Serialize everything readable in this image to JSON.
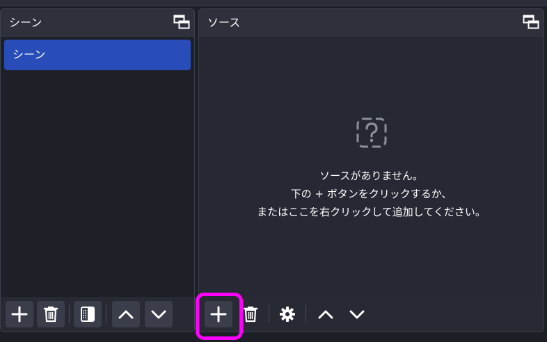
{
  "scenes": {
    "title": "シーン",
    "items": [
      {
        "label": "シーン"
      }
    ],
    "toolbar": [
      {
        "name": "add-scene-button",
        "icon": "plus-icon"
      },
      {
        "name": "remove-scene-button",
        "icon": "trash-icon"
      },
      {
        "name": "scene-filters-button",
        "icon": "filter-icon"
      },
      {
        "name": "move-scene-up-button",
        "icon": "chevron-up-icon"
      },
      {
        "name": "move-scene-down-button",
        "icon": "chevron-down-icon"
      }
    ]
  },
  "sources": {
    "title": "ソース",
    "empty": {
      "line1": "ソースがありません。",
      "line2": "下の + ボタンをクリックするか、",
      "line3": "またはここを右クリックして追加してください。"
    },
    "toolbar": [
      {
        "name": "add-source-button",
        "icon": "plus-icon"
      },
      {
        "name": "remove-source-button",
        "icon": "trash-icon"
      },
      {
        "name": "source-properties-button",
        "icon": "gear-icon"
      },
      {
        "name": "move-source-up-button",
        "icon": "chevron-up-icon"
      },
      {
        "name": "move-source-down-button",
        "icon": "chevron-down-icon"
      }
    ]
  },
  "colors": {
    "accent": "#284cb8",
    "highlight": "#ff00ff",
    "panel": "#272a33",
    "background": "#1d1f26"
  }
}
